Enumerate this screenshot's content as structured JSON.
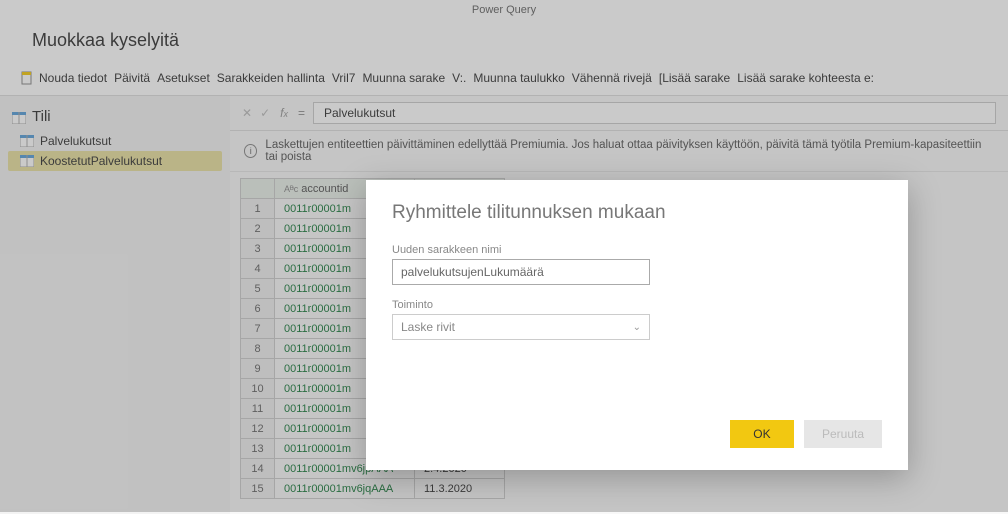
{
  "app_title": "Power Query",
  "page_title": "Muokkaa kyselyitä",
  "ribbon": {
    "get_data": "Nouda tiedot",
    "refresh": "Päivitä",
    "settings": "Asetukset",
    "manage_columns": "Sarakkeiden hallinta",
    "vril7": "Vril7",
    "transform_column": "Muunna sarake",
    "v_sep": "V:.",
    "transform_table": "Muunna taulukko",
    "reduce_rows": "Vähennä rivejä",
    "add_column": "[Lisää sarake",
    "add_column_from": "Lisää sarake kohteesta e:"
  },
  "sidebar": {
    "header": "Tili",
    "items": [
      {
        "label": "Palvelukutsut",
        "selected": false
      },
      {
        "label": "KoostetutPalvelukutsut",
        "selected": true
      }
    ]
  },
  "formula": {
    "value": "Palvelukutsut",
    "eq": "="
  },
  "info_bar": "Laskettujen entiteettien päivittäminen edellyttää Premiumia. Jos haluat ottaa päivityksen käyttöön, päivitä tämä työtila Premium-kapasiteettiin tai poista",
  "grid": {
    "col_header": "accountid",
    "type_prefix": "Aᴯc",
    "rows": [
      {
        "n": 1,
        "acct": "0011r00001m",
        "date": ""
      },
      {
        "n": 2,
        "acct": "0011r00001m",
        "date": ""
      },
      {
        "n": 3,
        "acct": "0011r00001m",
        "date": ""
      },
      {
        "n": 4,
        "acct": "0011r00001m",
        "date": ""
      },
      {
        "n": 5,
        "acct": "0011r00001m",
        "date": ""
      },
      {
        "n": 6,
        "acct": "0011r00001m",
        "date": ""
      },
      {
        "n": 7,
        "acct": "0011r00001m",
        "date": ""
      },
      {
        "n": 8,
        "acct": "0011r00001m",
        "date": ""
      },
      {
        "n": 9,
        "acct": "0011r00001m",
        "date": ""
      },
      {
        "n": 10,
        "acct": "0011r00001m",
        "date": ""
      },
      {
        "n": 11,
        "acct": "0011r00001m",
        "date": ""
      },
      {
        "n": 12,
        "acct": "0011r00001m",
        "date": ""
      },
      {
        "n": 13,
        "acct": "0011r00001m",
        "date": ""
      },
      {
        "n": 14,
        "acct": "0011r00001mv6jpAAA",
        "date": "2.4.2020"
      },
      {
        "n": 15,
        "acct": "0011r00001mv6jqAAA",
        "date": "11.3.2020"
      }
    ]
  },
  "dialog": {
    "title": "Ryhmittele tilitunnuksen mukaan",
    "col_name_label": "Uuden sarakkeen nimi",
    "col_name_value": "palvelukutsujenLukumäärä",
    "op_label": "Toiminto",
    "op_value": "Laske rivit",
    "ok": "OK",
    "cancel": "Peruuta"
  },
  "colors": {
    "accent": "#f2c811"
  }
}
